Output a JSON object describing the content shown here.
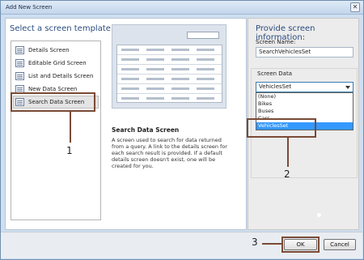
{
  "window": {
    "title": "Add New Screen",
    "close_glyph": "✕"
  },
  "left": {
    "heading": "Select a screen template:",
    "templates": [
      {
        "label": "Details Screen",
        "selected": false
      },
      {
        "label": "Editable Grid Screen",
        "selected": false
      },
      {
        "label": "List and Details Screen",
        "selected": false
      },
      {
        "label": "New Data Screen",
        "selected": false
      },
      {
        "label": "Search Data Screen",
        "selected": true
      }
    ],
    "description_title": "Search Data Screen",
    "description_text": "A screen used to search for data returned from a query.  A link to the details screen for each search result is provided.  If a default details screen doesn't exist, one will be created for you."
  },
  "right": {
    "heading": "Provide screen information:",
    "screen_name_label": "Screen Name:",
    "screen_name_value": "SearchVehiclesSet",
    "screen_data_label": "Screen Data",
    "screen_data_selected": "VehiclesSet",
    "screen_data_options": [
      "(None)",
      "Bikes",
      "Buses",
      "Cars",
      "VehiclesSet"
    ],
    "screen_data_highlighted": "VehiclesSet"
  },
  "annotations": {
    "n1": "1",
    "n2": "2",
    "n3": "3"
  },
  "buttons": {
    "ok": "OK",
    "cancel": "Cancel"
  },
  "colors": {
    "accent": "#2b4c80",
    "annotation": "#7a4a36",
    "selection": "#3399ff"
  },
  "icons": [
    "close-icon",
    "template-icon",
    "dropdown-arrow-icon"
  ]
}
